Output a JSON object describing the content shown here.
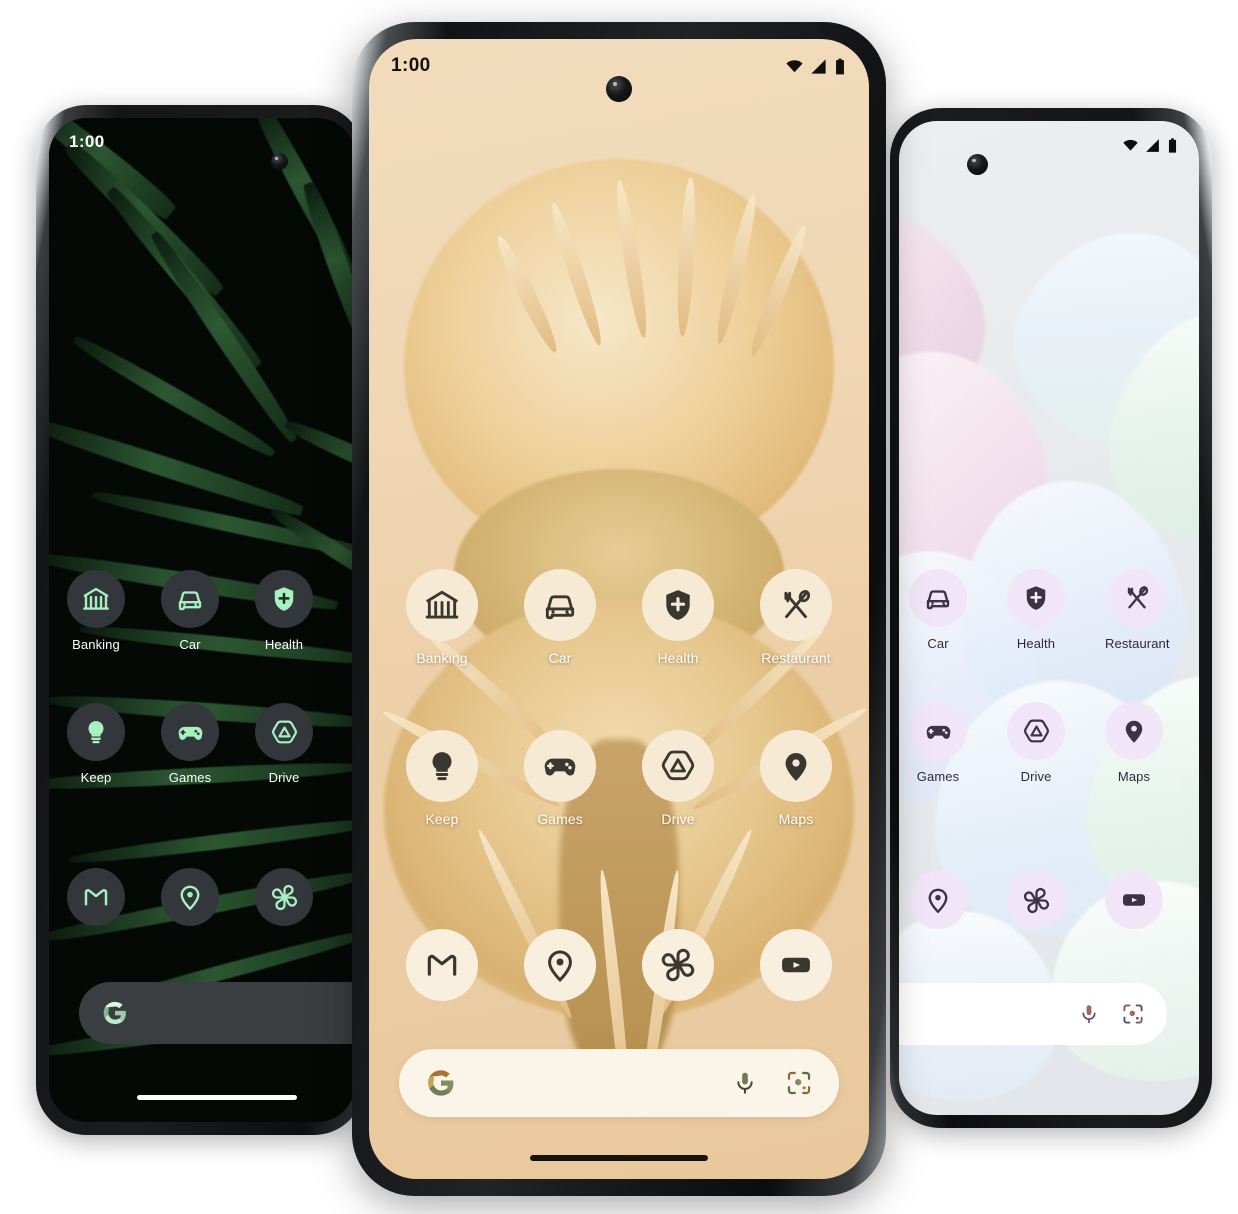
{
  "scene": {
    "title": "Pixel home screen themed icons showcase",
    "phone_count": 3,
    "background_color": "#ffffff"
  },
  "phones": [
    {
      "id": "left",
      "variant": "dark-theme",
      "wallpaper_name": "dark-palm-leaves",
      "status": {
        "time": "1:00",
        "wifi": "wifi-icon",
        "signal": "signal-icon",
        "battery": "battery-icon"
      },
      "colors": {
        "icon_bg": "#33363a",
        "icon_fg": "#a7f0c0",
        "label": "#ffffff",
        "search_bg": "#3b3e41",
        "wall_base": "#050906"
      },
      "apps": [
        [
          {
            "label": "Banking",
            "icon": "bank-icon"
          },
          {
            "label": "Car",
            "icon": "car-icon"
          },
          {
            "label": "Health",
            "icon": "health-shield-icon"
          }
        ],
        [
          {
            "label": "Keep",
            "icon": "lightbulb-icon"
          },
          {
            "label": "Games",
            "icon": "gamepad-icon"
          },
          {
            "label": "Drive",
            "icon": "drive-triangle-icon"
          }
        ]
      ],
      "dock": [
        {
          "label": "Gmail",
          "icon": "gmail-icon"
        },
        {
          "label": "Maps",
          "icon": "map-pin-icon"
        },
        {
          "label": "Photos",
          "icon": "photos-pinwheel-icon"
        }
      ],
      "search": {
        "logo": "google-g-icon",
        "placeholder": "",
        "value": ""
      },
      "nav_gesture_bar": true
    },
    {
      "id": "center",
      "variant": "light-cream-theme",
      "wallpaper_name": "pincushion-protea-flower",
      "status": {
        "time": "1:00",
        "wifi": "wifi-icon",
        "signal": "signal-icon",
        "battery": "battery-icon"
      },
      "colors": {
        "icon_bg": "#f7ead5",
        "icon_fg": "#3a3630",
        "label": "#ffffff",
        "search_bg": "#fbf4e8",
        "wall_base": "#f0d8b6",
        "g_blue": "#7b8a6a",
        "g_red": "#a9743c",
        "g_yellow": "#c8a košice"
      },
      "apps": [
        [
          {
            "label": "Banking",
            "icon": "bank-icon"
          },
          {
            "label": "Car",
            "icon": "car-icon"
          },
          {
            "label": "Health",
            "icon": "health-shield-icon"
          },
          {
            "label": "Restaurant",
            "icon": "fork-spoon-icon"
          }
        ],
        [
          {
            "label": "Keep",
            "icon": "lightbulb-icon"
          },
          {
            "label": "Games",
            "icon": "gamepad-icon"
          },
          {
            "label": "Drive",
            "icon": "drive-triangle-icon"
          },
          {
            "label": "Maps",
            "icon": "map-pin-icon"
          }
        ]
      ],
      "dock": [
        {
          "label": "Gmail",
          "icon": "gmail-icon"
        },
        {
          "label": "Maps",
          "icon": "map-pin-icon"
        },
        {
          "label": "Photos",
          "icon": "photos-pinwheel-icon"
        },
        {
          "label": "YouTube",
          "icon": "youtube-icon"
        }
      ],
      "search": {
        "logo": "google-g-icon",
        "placeholder": "",
        "value": "",
        "mic": "microphone-icon",
        "lens": "google-lens-icon"
      },
      "nav_gesture_bar": true
    },
    {
      "id": "right",
      "variant": "light-lavender-theme",
      "wallpaper_name": "pastel-orchid-petals",
      "status": {
        "time": "",
        "wifi": "wifi-icon",
        "signal": "signal-icon",
        "battery": "battery-icon"
      },
      "colors": {
        "icon_bg": "#f1e6f7",
        "icon_fg": "#3c3444",
        "label": "#2f2b35",
        "search_bg": "#ffffff",
        "wall_base": "#e9ecef"
      },
      "apps": [
        [
          {
            "label": "Car",
            "icon": "car-icon"
          },
          {
            "label": "Health",
            "icon": "health-shield-icon"
          },
          {
            "label": "Restaurant",
            "icon": "fork-spoon-icon"
          }
        ],
        [
          {
            "label": "Games",
            "icon": "gamepad-icon"
          },
          {
            "label": "Drive",
            "icon": "drive-triangle-icon"
          },
          {
            "label": "Maps",
            "icon": "map-pin-icon"
          }
        ]
      ],
      "dock": [
        {
          "label": "Maps",
          "icon": "map-pin-icon"
        },
        {
          "label": "Photos",
          "icon": "photos-pinwheel-icon"
        },
        {
          "label": "YouTube",
          "icon": "youtube-icon"
        }
      ],
      "search": {
        "logo": "google-g-icon",
        "placeholder": "",
        "value": "",
        "mic": "microphone-icon",
        "lens": "google-lens-icon"
      },
      "nav_gesture_bar": false
    }
  ]
}
